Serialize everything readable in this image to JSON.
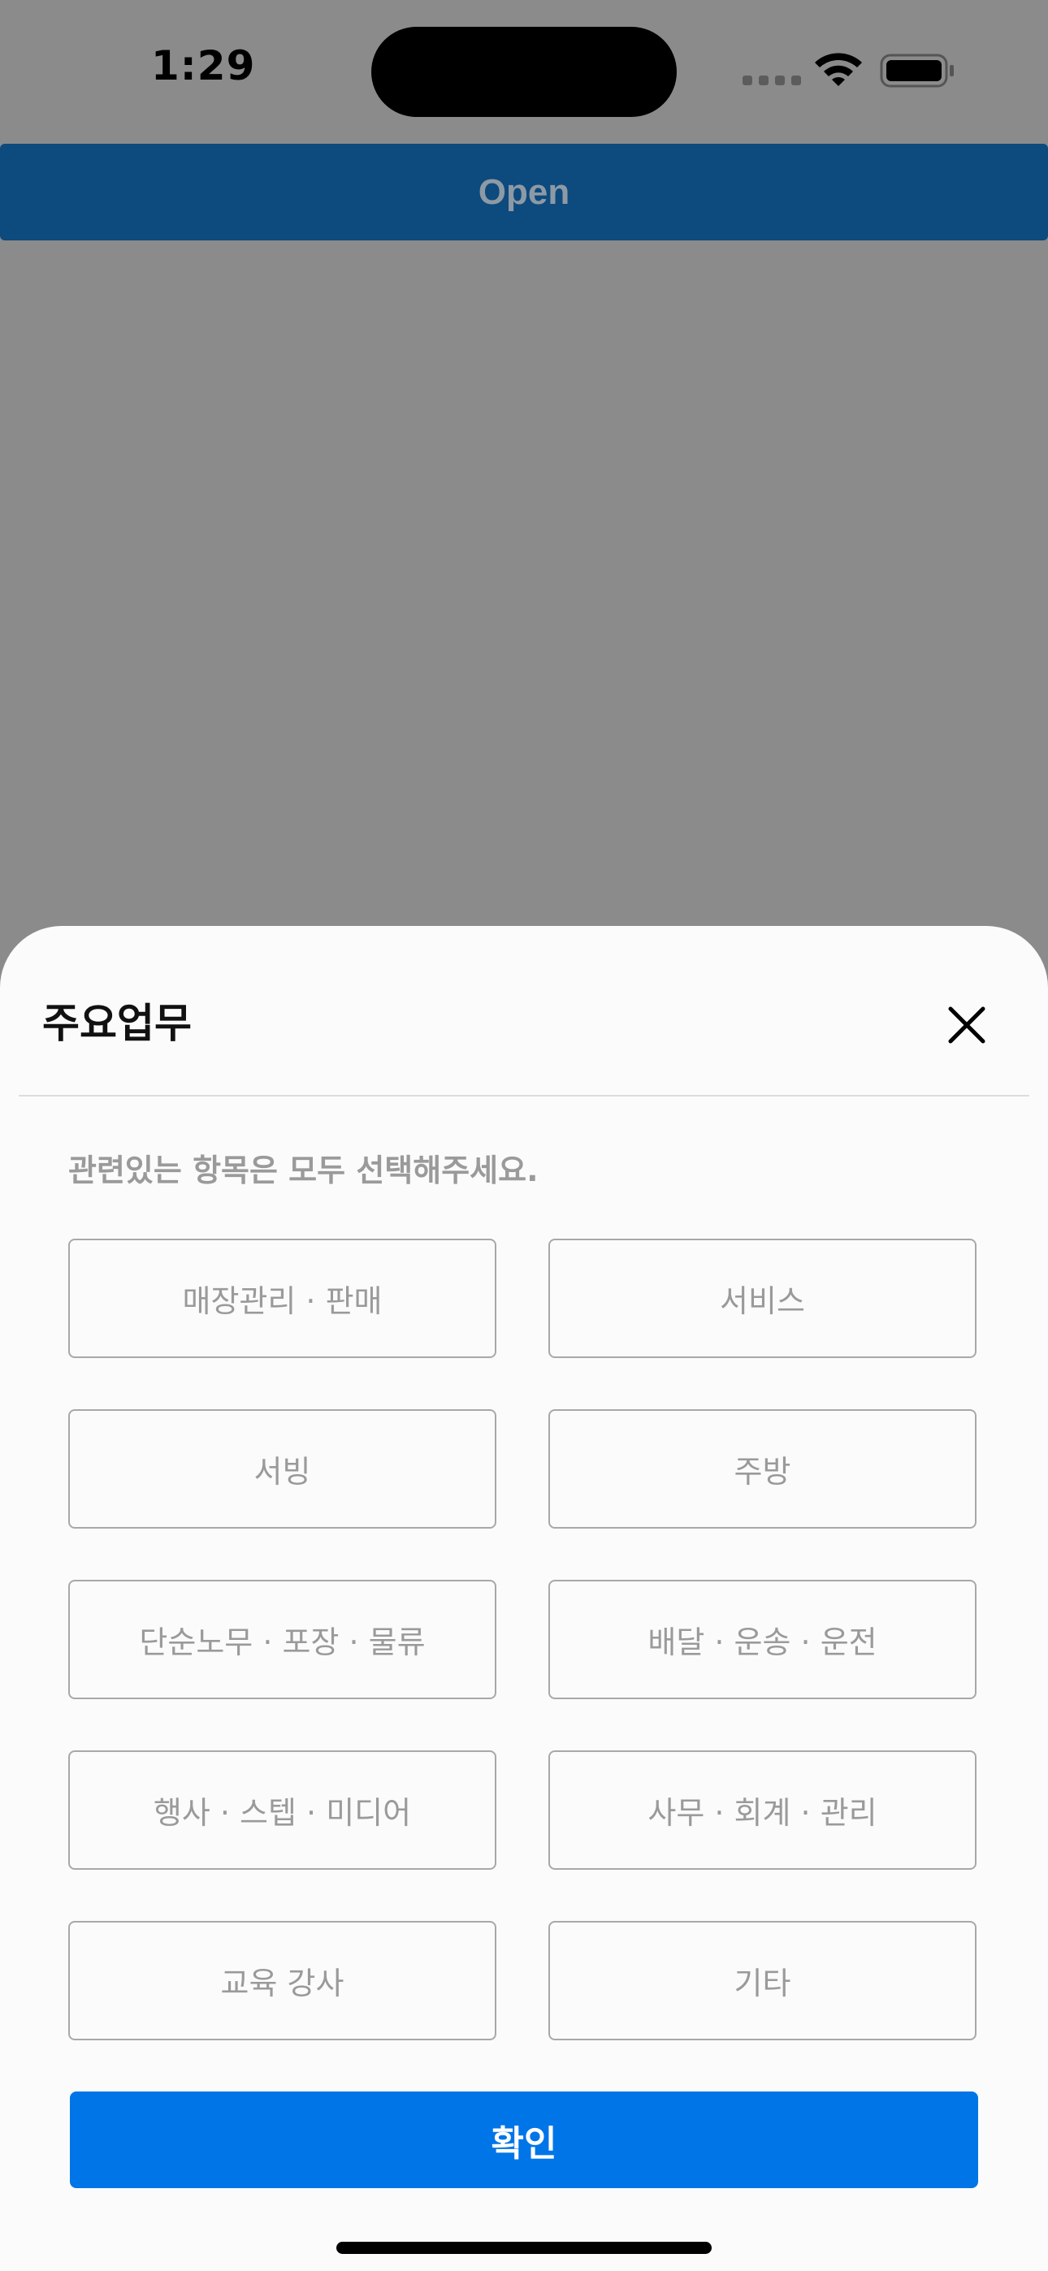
{
  "status_bar": {
    "time": "1:29",
    "icons": [
      "signal-icon",
      "wifi-icon",
      "battery-icon"
    ]
  },
  "open_bar": {
    "label": "Open"
  },
  "sheet": {
    "title": "주요업무",
    "subtitle": "관련있는 항목은 모두 선택해주세요.",
    "options": [
      {
        "label": "매장관리 · 판매"
      },
      {
        "label": "서비스"
      },
      {
        "label": "서빙"
      },
      {
        "label": "주방"
      },
      {
        "label": "단순노무 · 포장 · 물류"
      },
      {
        "label": "배달 · 운송 · 운전"
      },
      {
        "label": "행사 · 스텝 · 미디어"
      },
      {
        "label": "사무 · 회계 · 관리"
      },
      {
        "label": "교육 강사"
      },
      {
        "label": "기타"
      }
    ],
    "confirm_label": "확인"
  },
  "colors": {
    "overlay": "#8b8b8b",
    "open_bar": "#0d4a7e",
    "accent": "#0075e8",
    "option_border": "#a8a8a8",
    "option_text": "#9a9a9a"
  }
}
